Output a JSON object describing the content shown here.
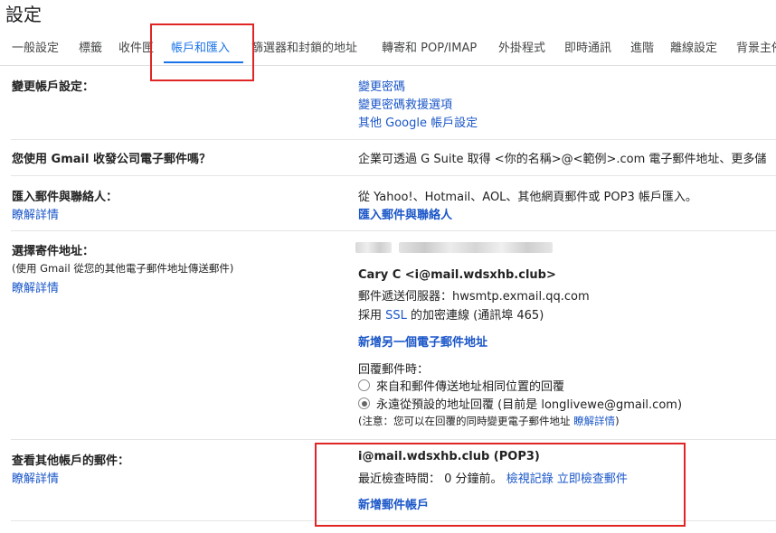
{
  "page_title": "設定",
  "tabs": [
    {
      "label": "一般設定"
    },
    {
      "label": "標籤"
    },
    {
      "label": "收件匣"
    },
    {
      "label": "帳戶和匯入"
    },
    {
      "label": "篩選器和封鎖的地址"
    },
    {
      "label": "轉寄和 POP/IMAP"
    },
    {
      "label": "外掛程式"
    },
    {
      "label": "即時通訊"
    },
    {
      "label": "進階"
    },
    {
      "label": "離線設定"
    },
    {
      "label": "背景主佈"
    }
  ],
  "active_tab": "帳戶和匯入",
  "sections": {
    "change_account": {
      "label": "變更帳戶設定：",
      "links": [
        "變更密碼",
        "變更密碼救援選項",
        "其他 Google 帳戶設定"
      ]
    },
    "business": {
      "label": "您使用 Gmail 收發公司電子郵件嗎？",
      "text": "企業可透過 G Suite 取得 <你的名稱>@<範例>.com 電子郵件地址、更多儲"
    },
    "import": {
      "label": "匯入郵件與聯絡人：",
      "learn_more": "瞭解詳情",
      "text": "從 Yahoo!、Hotmail、AOL、其他網頁郵件或 POP3 帳戶匯入。",
      "action": "匯入郵件與聯絡人"
    },
    "send_as": {
      "label": "選擇寄件地址：",
      "sub": "(使用 Gmail 從您的其他電子郵件地址傳送郵件)",
      "learn_more": "瞭解詳情",
      "account_name": "Cary C <i@mail.wdsxhb.club>",
      "server_prefix": "郵件遞送伺服器：",
      "server": "hwsmtp.exmail.qq.com",
      "ssl_prefix": "採用",
      "ssl_link": "SSL",
      "ssl_suffix": "的加密連線 (通訊埠 465)",
      "add_address": "新增另一個電子郵件地址",
      "reply_label": "回覆郵件時：",
      "reply_options": [
        {
          "label": "來自和郵件傳送地址相同位置的回覆",
          "checked": false
        },
        {
          "label": "永遠從預設的地址回覆 (目前是 longlivewe@gmail.com)",
          "checked": true
        }
      ],
      "note_prefix": "(注意：您可以在回覆的同時變更電子郵件地址",
      "note_link": "瞭解詳情",
      "note_suffix": ")"
    },
    "check_mail": {
      "label": "查看其他帳戶的郵件：",
      "learn_more": "瞭解詳情",
      "account": "i@mail.wdsxhb.club (POP3)",
      "last_checked": "最近檢查時間： 0 分鐘前。",
      "view_history": "檢視記錄",
      "check_now": "立即檢查郵件",
      "add_account": "新增郵件帳戶"
    }
  },
  "colors": {
    "link": "#1a56c8",
    "active_tab": "#1a73e8",
    "highlight_box": "#e02525"
  }
}
